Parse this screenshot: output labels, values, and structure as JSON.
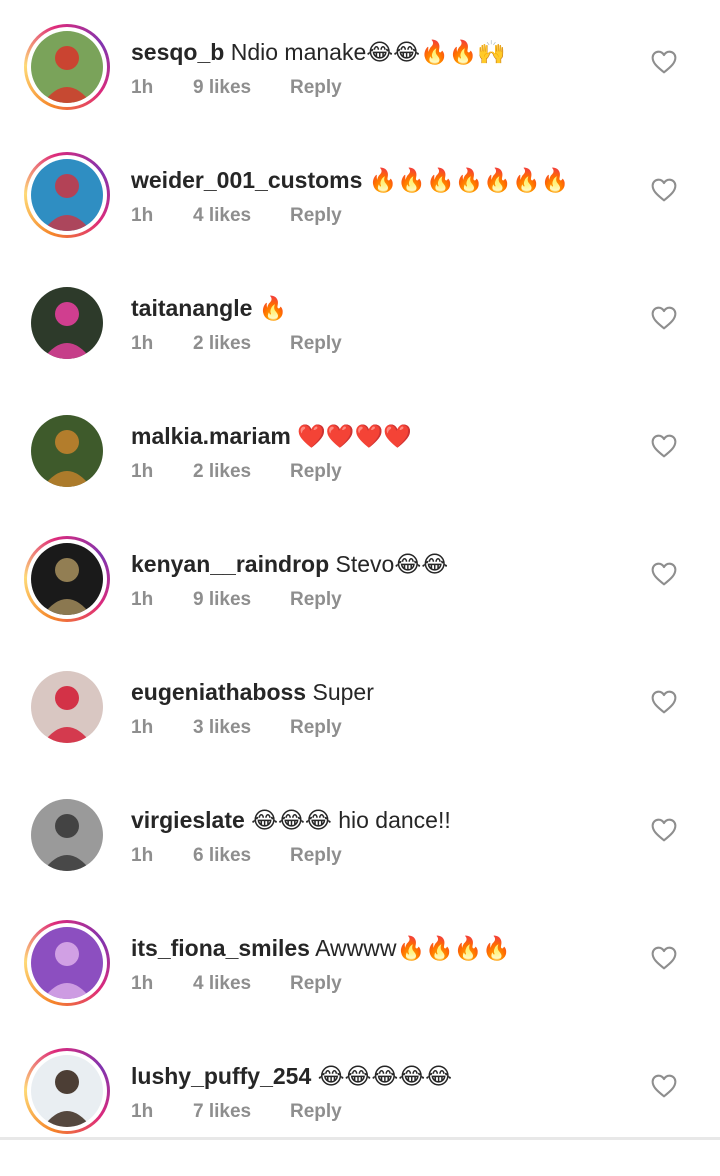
{
  "comments": [
    {
      "username": "sesqo_b",
      "text": " Ndio manake😂😂🔥🔥🙌",
      "time": "1h",
      "likes": "9 likes",
      "reply": "Reply",
      "story": true,
      "avatar": "avatar-person-red-outfit",
      "avatar_colors": [
        "#7aa35a",
        "#d33a2c"
      ]
    },
    {
      "username": "weider_001_customs",
      "text": " 🔥🔥🔥🔥🔥🔥🔥",
      "time": "1h",
      "likes": "4 likes",
      "reply": "Reply",
      "story": true,
      "avatar": "avatar-group-photo",
      "avatar_colors": [
        "#2f8ec2",
        "#c23a4a"
      ]
    },
    {
      "username": "taitanangle",
      "text": " 🔥",
      "time": "1h",
      "likes": "2 likes",
      "reply": "Reply",
      "story": false,
      "avatar": "avatar-pink-dress",
      "avatar_colors": [
        "#2d3a2a",
        "#e23f9a"
      ]
    },
    {
      "username": "malkia.mariam",
      "text": " ❤️❤️❤️❤️",
      "time": "1h",
      "likes": "2 likes",
      "reply": "Reply",
      "story": false,
      "avatar": "avatar-cartoon-character",
      "avatar_colors": [
        "#3e5a2b",
        "#c0812c"
      ]
    },
    {
      "username": "kenyan__raindrop",
      "text": " Stevo😂😂",
      "time": "1h",
      "likes": "9 likes",
      "reply": "Reply",
      "story": true,
      "avatar": "avatar-dark-figure",
      "avatar_colors": [
        "#1a1a1a",
        "#a08a5a"
      ]
    },
    {
      "username": "eugeniathaboss",
      "text": " Super",
      "time": "1h",
      "likes": "3 likes",
      "reply": "Reply",
      "story": false,
      "avatar": "avatar-woman-heart",
      "avatar_colors": [
        "#d9c7c2",
        "#d2213a"
      ]
    },
    {
      "username": "virgieslate",
      "text": " 😂😂😂 hio dance!!",
      "time": "1h",
      "likes": "6 likes",
      "reply": "Reply",
      "story": false,
      "avatar": "avatar-bw-hat",
      "avatar_colors": [
        "#9a9a9a",
        "#3a3a3a"
      ]
    },
    {
      "username": "its_fiona_smiles",
      "text": " Awwww🔥🔥🔥🔥",
      "time": "1h",
      "likes": "4 likes",
      "reply": "Reply",
      "story": true,
      "avatar": "avatar-purple-selfie",
      "avatar_colors": [
        "#8c4fc0",
        "#d8a8e8"
      ]
    },
    {
      "username": "lushy_puffy_254",
      "text": " 😂😂😂😂😂",
      "time": "1h",
      "likes": "7 likes",
      "reply": "Reply",
      "story": true,
      "avatar": "avatar-man-portrait",
      "avatar_colors": [
        "#e9eef2",
        "#3b2a20"
      ]
    }
  ],
  "colors": {
    "text": "#262626",
    "meta": "#8e8e8e",
    "heart_outline": "#8e8e8e"
  },
  "icons": {
    "like": "heart-outline-icon"
  }
}
